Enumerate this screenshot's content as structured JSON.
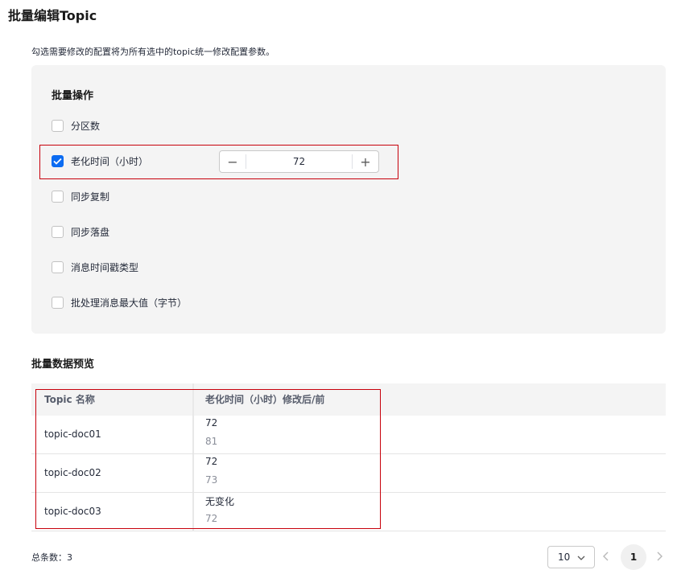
{
  "page_title": "批量编辑Topic",
  "description": "勾选需要修改的配置将为所有选中的topic统一修改配置参数。",
  "batch_panel": {
    "title": "批量操作",
    "options": [
      {
        "label": "分区数",
        "checked": false
      },
      {
        "label": "老化时间（小时）",
        "checked": true
      },
      {
        "label": "同步复制",
        "checked": false
      },
      {
        "label": "同步落盘",
        "checked": false
      },
      {
        "label": "消息时间戳类型",
        "checked": false
      },
      {
        "label": "批处理消息最大值（字节）",
        "checked": false
      }
    ],
    "stepper": {
      "value": "72",
      "minus": "−",
      "plus": "+"
    }
  },
  "preview": {
    "title": "批量数据预览",
    "columns": [
      "Topic 名称",
      "老化时间（小时）修改后/前"
    ],
    "rows": [
      {
        "name": "topic-doc01",
        "new": "72",
        "old": "81"
      },
      {
        "name": "topic-doc02",
        "new": "72",
        "old": "73"
      },
      {
        "name": "topic-doc03",
        "new": "无变化",
        "old": "72"
      }
    ]
  },
  "pagination": {
    "total_label": "总条数：3",
    "page_size": "10",
    "current_page": "1"
  },
  "colors": {
    "accent": "#0c6cf2",
    "highlight": "#c7000b",
    "panel_bg": "#f4f4f4"
  }
}
